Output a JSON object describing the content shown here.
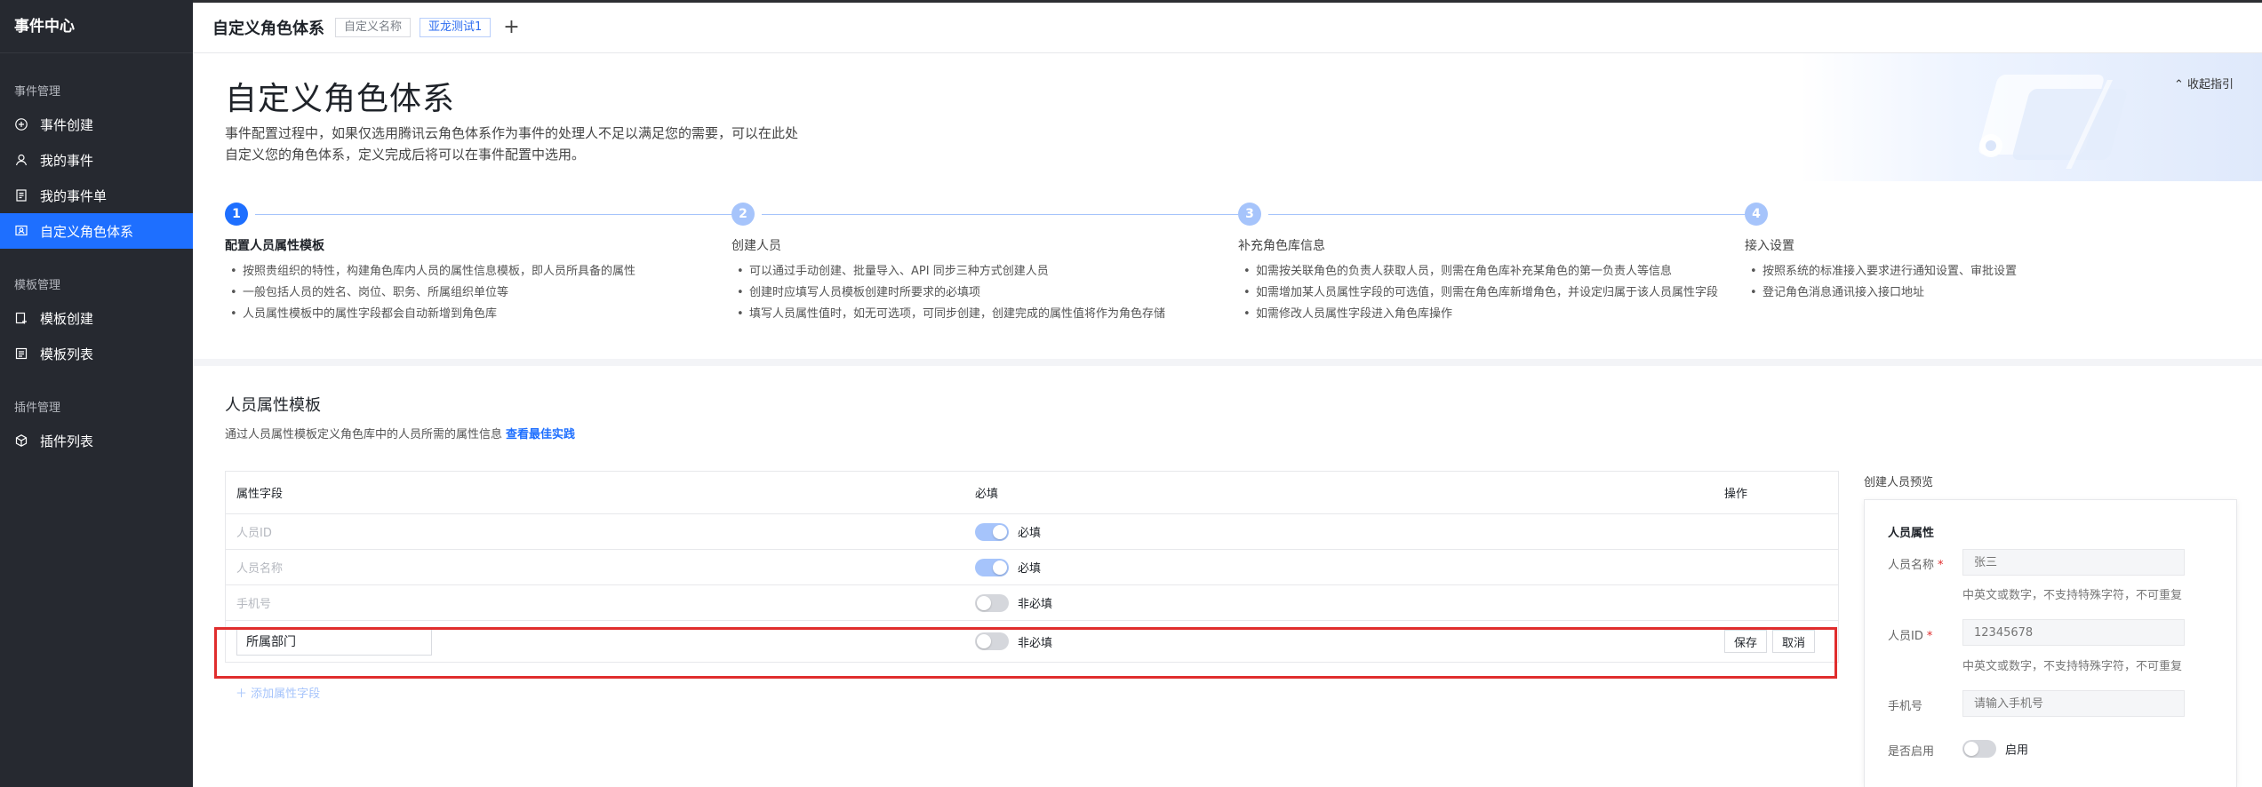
{
  "sidebar": {
    "brand": "事件中心",
    "groups": [
      {
        "label": "事件管理",
        "items": [
          {
            "label": "事件创建",
            "icon": "plus-circle-icon"
          },
          {
            "label": "我的事件",
            "icon": "user-icon"
          },
          {
            "label": "我的事件单",
            "icon": "document-icon"
          },
          {
            "label": "自定义角色体系",
            "icon": "role-system-icon",
            "active": true
          }
        ]
      },
      {
        "label": "模板管理",
        "items": [
          {
            "label": "模板创建",
            "icon": "template-add-icon"
          },
          {
            "label": "模板列表",
            "icon": "template-list-icon"
          }
        ]
      },
      {
        "label": "插件管理",
        "items": [
          {
            "label": "插件列表",
            "icon": "plugin-icon"
          }
        ]
      }
    ]
  },
  "topbar": {
    "title": "自定义角色体系",
    "tag_name": "自定义名称",
    "tag_user": "亚龙测试1",
    "add_symbol": "+"
  },
  "hero": {
    "title": "自定义角色体系",
    "description": "事件配置过程中，如果仅选用腾讯云角色体系作为事件的处理人不足以满足您的需要，可以在此处自定义您的角色体系，定义完成后将可以在事件配置中选用。",
    "collapse_label": "收起指引"
  },
  "steps": [
    {
      "num": "1",
      "name": "配置人员属性模板",
      "active": true,
      "points": [
        "按照贵组织的特性，构建角色库内人员的属性信息模板，即人员所具备的属性",
        "一般包括人员的姓名、岗位、职务、所属组织单位等",
        "人员属性模板中的属性字段都会自动新增到角色库"
      ]
    },
    {
      "num": "2",
      "name": "创建人员",
      "active": false,
      "points": [
        "可以通过手动创建、批量导入、API 同步三种方式创建人员",
        "创建时应填写人员模板创建时所要求的必填项",
        "填写人员属性值时，如无可选项，可同步创建，创建完成的属性值将作为角色存储"
      ]
    },
    {
      "num": "3",
      "name": "补充角色库信息",
      "active": false,
      "points": [
        "如需按关联角色的负责人获取人员，则需在角色库补充某角色的第一负责人等信息",
        "如需增加某人员属性字段的可选值，则需在角色库新增角色，并设定归属于该人员属性字段",
        "如需修改人员属性字段进入角色库操作"
      ]
    },
    {
      "num": "4",
      "name": "接入设置",
      "active": false,
      "points": [
        "按照系统的标准接入要求进行通知设置、审批设置",
        "登记角色消息通讯接入接口地址"
      ]
    }
  ],
  "section": {
    "title": "人员属性模板",
    "description": "通过人员属性模板定义角色库中的人员所需的属性信息",
    "best_practice_link": "查看最佳实践"
  },
  "table": {
    "headers": {
      "field": "属性字段",
      "required": "必填",
      "action": "操作"
    },
    "rows": [
      {
        "field": "人员ID",
        "required": true,
        "required_text": "必填"
      },
      {
        "field": "人员名称",
        "required": true,
        "required_text": "必填"
      },
      {
        "field": "手机号",
        "required": false,
        "required_text": "非必填"
      }
    ],
    "editing_row": {
      "value": "所属部门",
      "required": false,
      "required_text": "非必填",
      "save_label": "保存",
      "cancel_label": "取消"
    },
    "add_label": "添加属性字段"
  },
  "preview": {
    "section_title": "创建人员预览",
    "card_title": "人员属性",
    "fields": [
      {
        "label": "人员名称",
        "required": true,
        "placeholder": "张三",
        "hint": "中英文或数字，不支持特殊字符，不可重复"
      },
      {
        "label": "人员ID",
        "required": true,
        "placeholder": "12345678",
        "hint": "中英文或数字，不支持特殊字符，不可重复"
      },
      {
        "label": "手机号",
        "required": false,
        "placeholder": "请输入手机号"
      }
    ],
    "enabled_label": "是否启用",
    "enabled_toggle_label": "启用",
    "enabled": false
  },
  "colors": {
    "sidebar_bg": "#262930",
    "active_blue": "#1e6fff",
    "light_blue": "#a6c4fb",
    "highlight_red": "#e02d2d"
  }
}
